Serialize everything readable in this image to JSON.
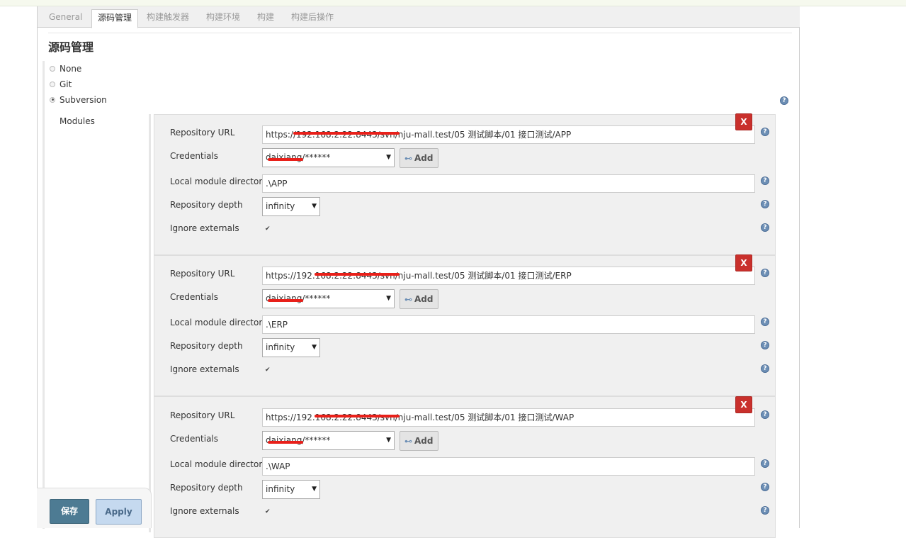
{
  "tabs": [
    {
      "label": "General"
    },
    {
      "label": "源码管理"
    },
    {
      "label": "构建触发器"
    },
    {
      "label": "构建环境"
    },
    {
      "label": "构建"
    },
    {
      "label": "构建后操作"
    }
  ],
  "section_title": "源码管理",
  "scm_options": [
    {
      "label": "None",
      "selected": false
    },
    {
      "label": "Git",
      "selected": false
    },
    {
      "label": "Subversion",
      "selected": true
    }
  ],
  "modules_label": "Modules",
  "field_labels": {
    "repo_url": "Repository URL",
    "credentials": "Credentials",
    "local_dir": "Local module directory",
    "depth": "Repository depth",
    "ignore_externals": "Ignore externals"
  },
  "add_label": "Add",
  "delete_label": "X",
  "help_glyph": "?",
  "modules": [
    {
      "repo_url": "https://192.168.2.22:8443/svn/nju-mall.test/05 测试脚本/01 接口测试/APP",
      "credentials": "daixiang/******",
      "local_dir": ".\\APP",
      "depth": "infinity",
      "ignore_externals": true
    },
    {
      "repo_url": "https://192.168.2.22:8443/svn/nju-mall.test/05 测试脚本/01 接口测试/ERP",
      "credentials": "daixiang/******",
      "local_dir": ".\\ERP",
      "depth": "infinity",
      "ignore_externals": true
    },
    {
      "repo_url": "https://192.168.2.22:8443/svn/nju-mall.test/05 测试脚本/01 接口测试/WAP",
      "credentials": "daixiang/******",
      "local_dir": ".\\WAP",
      "depth": "infinity",
      "ignore_externals": true
    }
  ],
  "buttons": {
    "save": "保存",
    "apply": "Apply"
  },
  "colors": {
    "delete": "#c9302c",
    "save": "#4d7b93",
    "apply": "#c5d9ef",
    "help": "#6d8fb5",
    "redaction": "#e8201a"
  }
}
